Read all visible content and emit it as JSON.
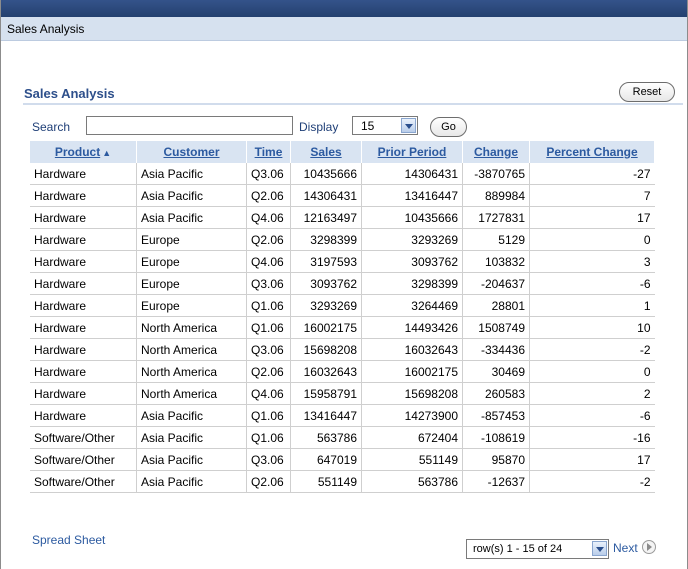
{
  "page": {
    "header_title": "Sales Analysis",
    "region_title": "Sales Analysis",
    "reset_label": "Reset"
  },
  "search": {
    "label": "Search",
    "value": "",
    "placeholder": ""
  },
  "display": {
    "label": "Display",
    "selected": "15",
    "go_label": "Go"
  },
  "table": {
    "headers": [
      "Product",
      "Customer",
      "Time",
      "Sales",
      "Prior Period",
      "Change",
      "Percent Change"
    ],
    "sort_indicator": "▲",
    "rows": [
      [
        "Hardware",
        "Asia Pacific",
        "Q3.06",
        "10435666",
        "14306431",
        "-3870765",
        "-27"
      ],
      [
        "Hardware",
        "Asia Pacific",
        "Q2.06",
        "14306431",
        "13416447",
        "889984",
        "7"
      ],
      [
        "Hardware",
        "Asia Pacific",
        "Q4.06",
        "12163497",
        "10435666",
        "1727831",
        "17"
      ],
      [
        "Hardware",
        "Europe",
        "Q2.06",
        "3298399",
        "3293269",
        "5129",
        "0"
      ],
      [
        "Hardware",
        "Europe",
        "Q4.06",
        "3197593",
        "3093762",
        "103832",
        "3"
      ],
      [
        "Hardware",
        "Europe",
        "Q3.06",
        "3093762",
        "3298399",
        "-204637",
        "-6"
      ],
      [
        "Hardware",
        "Europe",
        "Q1.06",
        "3293269",
        "3264469",
        "28801",
        "1"
      ],
      [
        "Hardware",
        "North America",
        "Q1.06",
        "16002175",
        "14493426",
        "1508749",
        "10"
      ],
      [
        "Hardware",
        "North America",
        "Q3.06",
        "15698208",
        "16032643",
        "-334436",
        "-2"
      ],
      [
        "Hardware",
        "North America",
        "Q2.06",
        "16032643",
        "16002175",
        "30469",
        "0"
      ],
      [
        "Hardware",
        "North America",
        "Q4.06",
        "15958791",
        "15698208",
        "260583",
        "2"
      ],
      [
        "Hardware",
        "Asia Pacific",
        "Q1.06",
        "13416447",
        "14273900",
        "-857453",
        "-6"
      ],
      [
        "Software/Other",
        "Asia Pacific",
        "Q1.06",
        "563786",
        "672404",
        "-108619",
        "-16"
      ],
      [
        "Software/Other",
        "Asia Pacific",
        "Q3.06",
        "647019",
        "551149",
        "95870",
        "17"
      ],
      [
        "Software/Other",
        "Asia Pacific",
        "Q2.06",
        "551149",
        "563786",
        "-12637",
        "-2"
      ]
    ]
  },
  "footer": {
    "spreadsheet_link": "Spread Sheet",
    "pagination_selected": "row(s) 1 - 15 of 24",
    "next_label": "Next"
  },
  "icons": {
    "dropdown": "chevron-down-icon",
    "next": "next-arrow-icon",
    "sort": "sort-ascending-icon"
  },
  "colors": {
    "header_strip": "#2b4a80",
    "title_bar": "#d6e1ef",
    "link_blue": "#2c5aa0",
    "table_header_bg": "#d9e4f2"
  }
}
